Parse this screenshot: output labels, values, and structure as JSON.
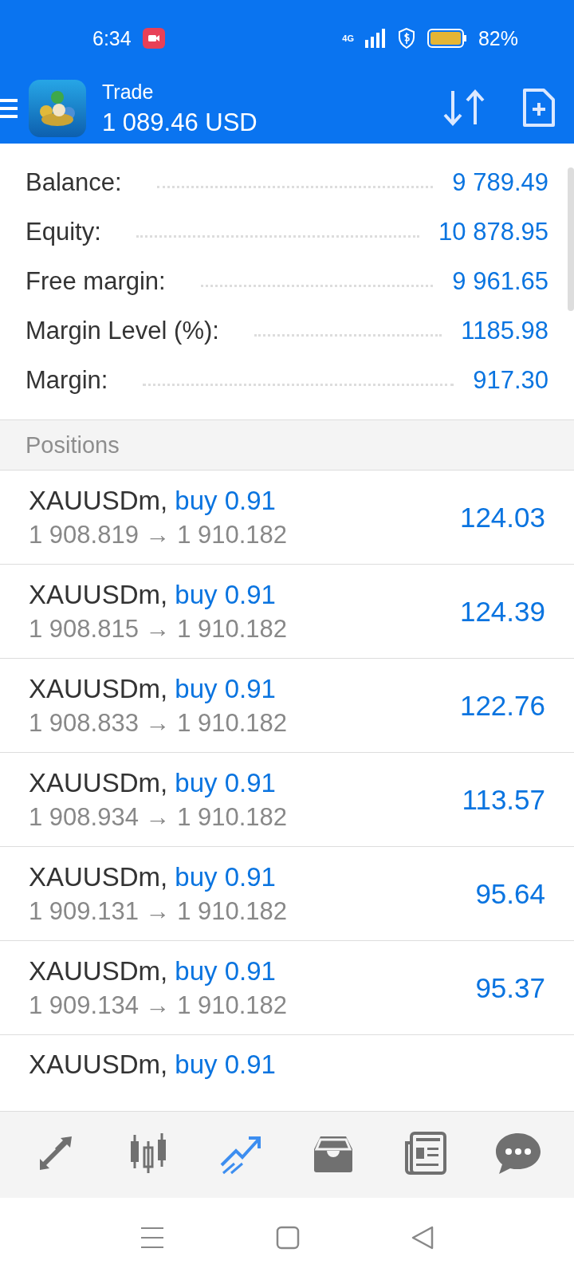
{
  "status_bar": {
    "time": "6:34",
    "network": "4G",
    "battery": "82%"
  },
  "header": {
    "title": "Trade",
    "subtitle": "1 089.46 USD"
  },
  "summary": [
    {
      "label": "Balance:",
      "value": "9 789.49"
    },
    {
      "label": "Equity:",
      "value": "10 878.95"
    },
    {
      "label": "Free margin:",
      "value": "9 961.65"
    },
    {
      "label": "Margin Level (%):",
      "value": "1185.98"
    },
    {
      "label": "Margin:",
      "value": "917.30"
    }
  ],
  "section": "Positions",
  "positions": [
    {
      "symbol": "XAUUSDm,",
      "order": "buy 0.91",
      "prices": "1 908.819 → 1 910.182",
      "profit": "124.03"
    },
    {
      "symbol": "XAUUSDm,",
      "order": "buy 0.91",
      "prices": "1 908.815 → 1 910.182",
      "profit": "124.39"
    },
    {
      "symbol": "XAUUSDm,",
      "order": "buy 0.91",
      "prices": "1 908.833 → 1 910.182",
      "profit": "122.76"
    },
    {
      "symbol": "XAUUSDm,",
      "order": "buy 0.91",
      "prices": "1 908.934 → 1 910.182",
      "profit": "113.57"
    },
    {
      "symbol": "XAUUSDm,",
      "order": "buy 0.91",
      "prices": "1 909.131 → 1 910.182",
      "profit": "95.64"
    },
    {
      "symbol": "XAUUSDm,",
      "order": "buy 0.91",
      "prices": "1 909.134 → 1 910.182",
      "profit": "95.37"
    },
    {
      "symbol": "XAUUSDm,",
      "order": "buy 0.91"
    }
  ],
  "bottom_nav": [
    {
      "kind": "quotes",
      "selected": false
    },
    {
      "kind": "chart",
      "selected": false
    },
    {
      "kind": "trade",
      "selected": true
    },
    {
      "kind": "history",
      "selected": false
    },
    {
      "kind": "news",
      "selected": false
    },
    {
      "kind": "chat",
      "selected": false
    }
  ]
}
